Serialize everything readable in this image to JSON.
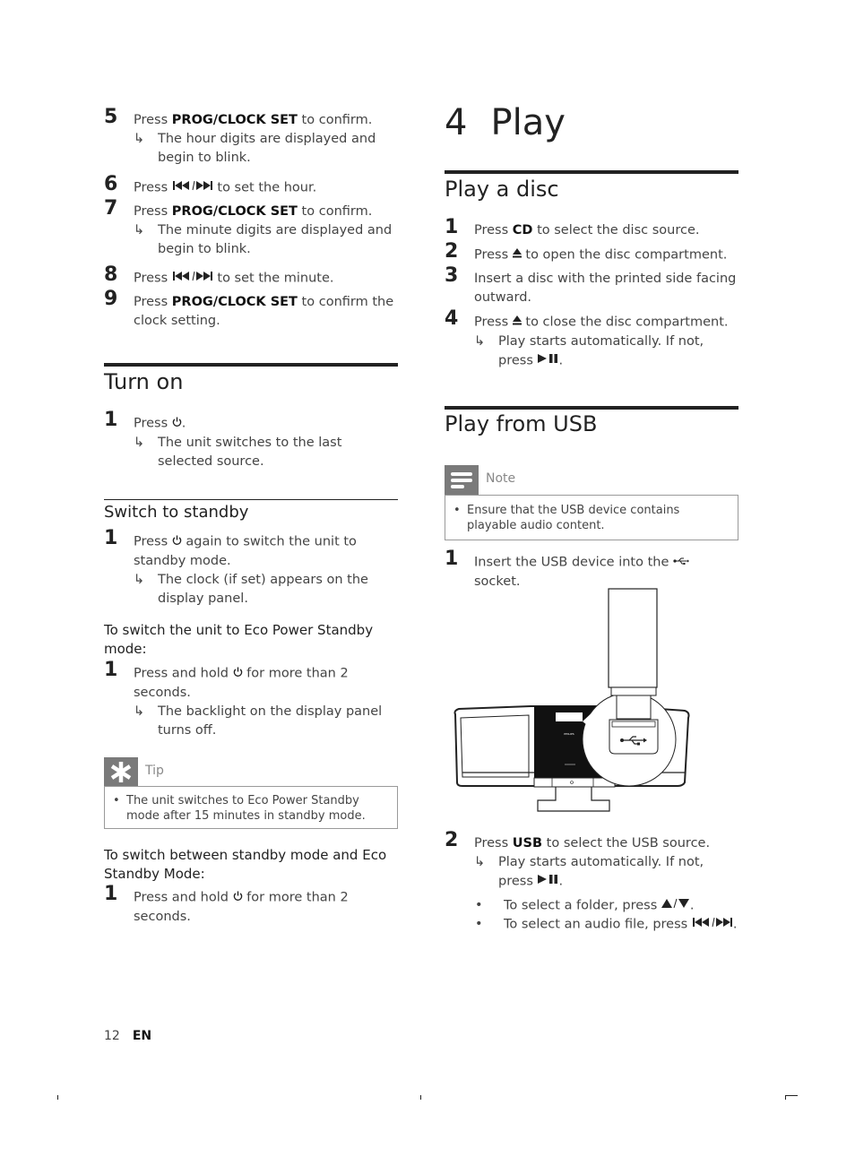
{
  "left": {
    "clock_steps": [
      {
        "num": "5",
        "pre": "Press ",
        "bold": "PROG/CLOCK SET",
        "post": " to confirm.",
        "result": "The hour digits are displayed and begin to blink."
      },
      {
        "num": "6",
        "pre": "Press ",
        "icon": "prev-next",
        "post": " to set the hour."
      },
      {
        "num": "7",
        "pre": "Press ",
        "bold": "PROG/CLOCK SET",
        "post": " to confirm.",
        "result": "The minute digits are displayed and begin to blink."
      },
      {
        "num": "8",
        "pre": "Press ",
        "icon": "prev-next",
        "post": " to set the minute."
      },
      {
        "num": "9",
        "pre": "Press ",
        "bold": "PROG/CLOCK SET",
        "post": " to confirm the clock setting."
      }
    ],
    "turn_on": {
      "title": "Turn on",
      "steps": [
        {
          "num": "1",
          "pre": "Press ",
          "icon": "power",
          "post": ".",
          "result": "The unit switches to the last selected source."
        }
      ]
    },
    "standby": {
      "title": "Switch to standby",
      "steps": [
        {
          "num": "1",
          "pre": "Press ",
          "icon": "power",
          "post": " again to switch the unit to standby mode.",
          "result": "The clock (if set) appears on the display panel."
        }
      ]
    },
    "eco": {
      "title": "To switch the unit to Eco Power Standby mode:",
      "steps": [
        {
          "num": "1",
          "pre": "Press and hold ",
          "icon": "power",
          "post": " for more than 2 seconds.",
          "result": "The backlight on the display panel turns off."
        }
      ]
    },
    "tip": {
      "label": "Tip",
      "text": "The unit switches to Eco Power Standby mode after 15 minutes in standby mode."
    },
    "switch_between": {
      "title": "To switch between standby mode and Eco Standby Mode:",
      "steps": [
        {
          "num": "1",
          "pre": "Press and hold ",
          "icon": "power",
          "post": " for more than 2 seconds."
        }
      ]
    }
  },
  "right": {
    "chapter": {
      "num": "4",
      "title": "Play"
    },
    "play_disc": {
      "title": "Play a disc",
      "steps": [
        {
          "num": "1",
          "pre": "Press ",
          "bold": "CD",
          "post": " to select the disc source."
        },
        {
          "num": "2",
          "pre": "Press ",
          "icon": "eject",
          "post": " to open the disc compartment."
        },
        {
          "num": "3",
          "pre": "Insert a disc with the printed side facing outward."
        },
        {
          "num": "4",
          "pre": "Press ",
          "icon": "eject",
          "post": " to close the disc compartment.",
          "result_pre": "Play starts automatically. If not, press ",
          "result_icon": "play-pause",
          "result_post": "."
        }
      ]
    },
    "play_usb": {
      "title": "Play from USB",
      "note": {
        "label": "Note",
        "text": "Ensure that the USB device contains playable audio content."
      },
      "step1": {
        "num": "1",
        "pre": "Insert the USB device into the ",
        "icon": "usb",
        "post": " socket."
      },
      "step2": {
        "num": "2",
        "pre": "Press ",
        "bold": "USB",
        "post": " to select the USB source.",
        "result_pre": "Play starts automatically. If not, press ",
        "result_icon": "play-pause",
        "result_post": "."
      },
      "bullets": [
        {
          "pre": "To select a folder, press ",
          "icon": "up-down",
          "post": "."
        },
        {
          "pre": "To select an audio file, press ",
          "icon": "prev-next",
          "post": "."
        }
      ],
      "illustration": {
        "brand_text": "PHILIPS"
      }
    }
  },
  "footer": {
    "page": "12",
    "lang": "EN"
  }
}
